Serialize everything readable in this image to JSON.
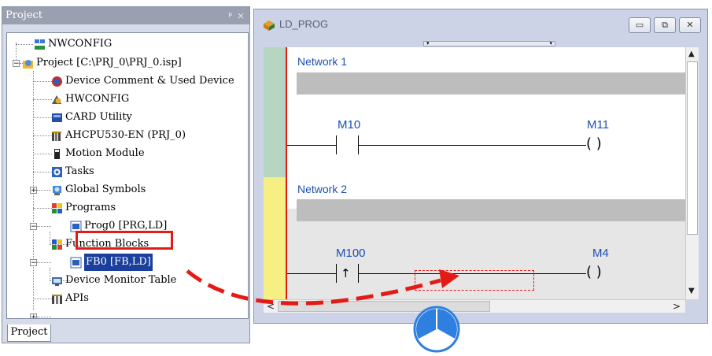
{
  "project_pane": {
    "title": "Project",
    "pin_glyph": "ᵖ",
    "close_glyph": "×",
    "tab_label": "Project",
    "tree": [
      {
        "label": "NWCONFIG",
        "icon": "network-config-icon"
      },
      {
        "label": "Project [C:\\PRJ_0\\PRJ_0.isp]",
        "icon": "project-icon",
        "expander": "−"
      },
      {
        "label": "Device Comment & Used Device",
        "icon": "device-comment-icon"
      },
      {
        "label": "HWCONFIG",
        "icon": "hardware-config-icon"
      },
      {
        "label": "CARD Utility",
        "icon": "card-utility-icon"
      },
      {
        "label": "AHCPU530-EN  (PRJ_0)",
        "icon": "cpu-module-icon"
      },
      {
        "label": "Motion Module",
        "icon": "motion-module-icon"
      },
      {
        "label": "Tasks",
        "icon": "tasks-icon",
        "expander": "+"
      },
      {
        "label": "Global Symbols",
        "icon": "global-symbols-icon"
      },
      {
        "label": "Programs",
        "icon": "programs-icon",
        "expander": "−"
      },
      {
        "label": "Prog0 [PRG,LD]",
        "icon": "program-unit-icon"
      },
      {
        "label": "Function Blocks",
        "icon": "function-blocks-icon",
        "expander": "−"
      },
      {
        "label": "FB0 [FB,LD]",
        "icon": "function-block-unit-icon",
        "selected": true
      },
      {
        "label": "Device Monitor Table",
        "icon": "monitor-table-icon"
      },
      {
        "label": "APIs",
        "icon": "apis-icon",
        "expander": "+"
      }
    ]
  },
  "ld_window": {
    "title": "LD_PROG",
    "minimize_glyph": "▭",
    "maximize_glyph": "⧉",
    "close_glyph": "✕",
    "networks": [
      {
        "label": "Network 1",
        "contact": "M10",
        "coil": "M11"
      },
      {
        "label": "Network 2",
        "contact": "M100",
        "coil": "M4"
      }
    ],
    "coil_glyph": "(  )",
    "rising_edge_glyph": "↑",
    "scroll_left": "<",
    "scroll_right": ">",
    "scroll_up": "▲",
    "scroll_down": "▼"
  },
  "colors": {
    "selection_red": "#e31b17",
    "network_label_blue": "#1b4fb5",
    "gutter_green": "#b7d6c2",
    "gutter_yellow": "#f6ef84"
  }
}
